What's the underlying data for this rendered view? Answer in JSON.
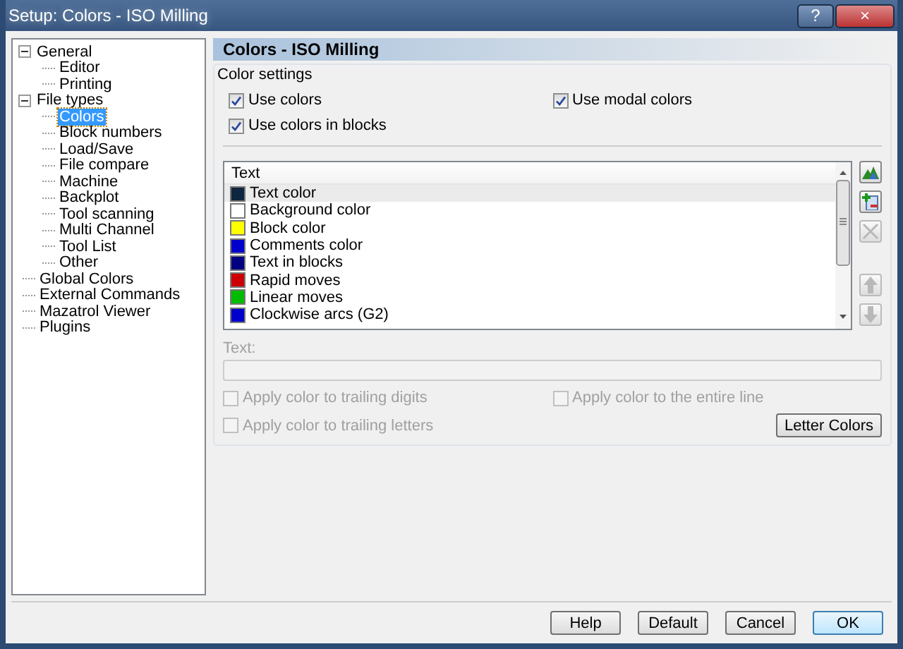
{
  "window": {
    "title": "Setup: Colors - ISO Milling",
    "help_button": "?",
    "close_button": "×"
  },
  "tree": [
    {
      "label": "General",
      "expanded": true,
      "selected": false,
      "children": [
        {
          "label": "Editor",
          "selected": false
        },
        {
          "label": "Printing",
          "selected": false
        }
      ]
    },
    {
      "label": "File types",
      "expanded": true,
      "selected": false,
      "children": [
        {
          "label": "Colors",
          "selected": true
        },
        {
          "label": "Block numbers",
          "selected": false
        },
        {
          "label": "Load/Save",
          "selected": false
        },
        {
          "label": "File compare",
          "selected": false
        },
        {
          "label": "Machine",
          "selected": false
        },
        {
          "label": "Backplot",
          "selected": false
        },
        {
          "label": "Tool scanning",
          "selected": false
        },
        {
          "label": "Multi Channel",
          "selected": false
        },
        {
          "label": "Tool List",
          "selected": false
        },
        {
          "label": "Other",
          "selected": false
        }
      ]
    },
    {
      "label": "Global Colors",
      "selected": false
    },
    {
      "label": "External Commands",
      "selected": false
    },
    {
      "label": "Mazatrol Viewer",
      "selected": false
    },
    {
      "label": "Plugins",
      "selected": false
    }
  ],
  "page_title": "Colors - ISO Milling",
  "group": {
    "title": "Color settings",
    "options": [
      {
        "label": "Use colors",
        "checked": true,
        "disabled": false
      },
      {
        "label": "Use modal colors",
        "checked": true,
        "disabled": false
      },
      {
        "label": "Use colors in blocks",
        "checked": true,
        "disabled": false
      }
    ],
    "list": {
      "column": "Text",
      "rows": [
        {
          "label": "Text color",
          "color": "#0f2640",
          "selected": true
        },
        {
          "label": "Background color",
          "color": "#ffffff",
          "selected": false
        },
        {
          "label": "Block color",
          "color": "#ffff00",
          "selected": false
        },
        {
          "label": "Comments color",
          "color": "#0000cc",
          "selected": false
        },
        {
          "label": "Text in blocks",
          "color": "#000080",
          "selected": false
        },
        {
          "label": "Rapid moves",
          "color": "#cc0000",
          "selected": false
        },
        {
          "label": "Linear moves",
          "color": "#00bb00",
          "selected": false
        },
        {
          "label": "Clockwise arcs (G2)",
          "color": "#0000cc",
          "selected": false
        }
      ]
    },
    "side_buttons": [
      {
        "kind": "find",
        "disabled": false
      },
      {
        "kind": "add",
        "disabled": false
      },
      {
        "kind": "delete",
        "disabled": true
      },
      {
        "kind": "up",
        "disabled": true
      },
      {
        "kind": "down",
        "disabled": true
      }
    ],
    "text_field": {
      "label": "Text:",
      "disabled": true
    },
    "apply_options": [
      {
        "label": "Apply color to trailing digits",
        "checked": false,
        "disabled": true
      },
      {
        "label": "Apply color to the entire line",
        "checked": false,
        "disabled": true
      },
      {
        "label": "Apply color to trailing letters",
        "checked": false,
        "disabled": true
      }
    ],
    "letter_colors_button": "Letter Colors"
  },
  "buttons": [
    {
      "label": "Help",
      "default": false
    },
    {
      "label": "Default",
      "default": false
    },
    {
      "label": "Cancel",
      "default": false
    },
    {
      "label": "OK",
      "default": true
    }
  ]
}
